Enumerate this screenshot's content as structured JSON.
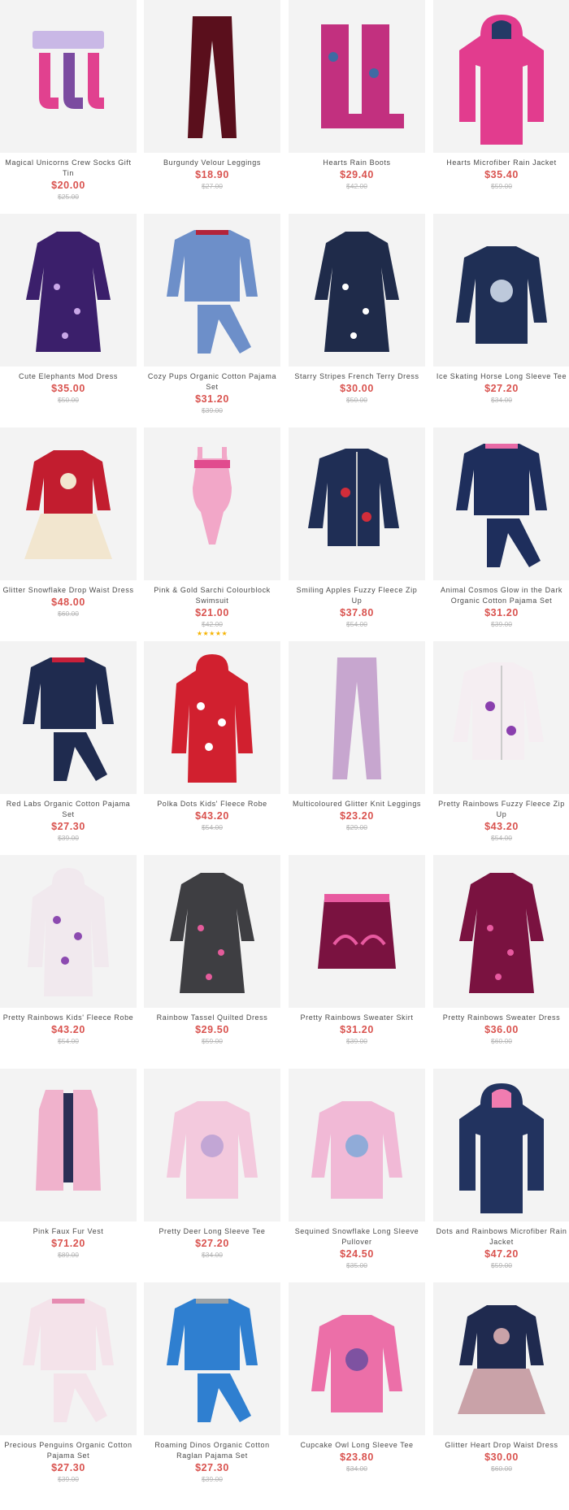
{
  "products": [
    {
      "name": "Magical Unicorns Crew Socks Gift Tin",
      "price": "$20.00",
      "was": "$25.00",
      "type": "socks",
      "color": "#e1418f",
      "accent": "#7b4ba0"
    },
    {
      "name": "Burgundy Velour Leggings",
      "price": "$18.90",
      "was": "$27.00",
      "type": "leggings",
      "color": "#5a0f1c",
      "accent": "#3a0610"
    },
    {
      "name": "Hearts Rain Boots",
      "price": "$29.40",
      "was": "$42.00",
      "type": "boots",
      "color": "#c2307f",
      "accent": "#3f6aa3"
    },
    {
      "name": "Hearts Microfiber Rain Jacket",
      "price": "$35.40",
      "was": "$59.00",
      "type": "jacket",
      "color": "#e23c8e",
      "accent": "#243a66"
    },
    {
      "name": "Cute Elephants Mod Dress",
      "price": "$35.00",
      "was": "$50.00",
      "type": "dress",
      "color": "#3b1f6b",
      "accent": "#c9a7e8"
    },
    {
      "name": "Cozy Pups Organic Cotton Pajama Set",
      "price": "$31.20",
      "was": "$39.00",
      "type": "pajama",
      "color": "#6d8fc9",
      "accent": "#b3243a"
    },
    {
      "name": "Starry Stripes French Terry Dress",
      "price": "$30.00",
      "was": "$50.00",
      "type": "dress",
      "color": "#1f2b4a",
      "accent": "#ffffff"
    },
    {
      "name": "Ice Skating Horse Long Sleeve Tee",
      "price": "$27.20",
      "was": "$34.00",
      "type": "tee",
      "color": "#1f2f55",
      "accent": "#d9e4f3"
    },
    {
      "name": "Glitter Snowflake Drop Waist Dress",
      "price": "$48.00",
      "was": "$60.00",
      "type": "tutu",
      "color": "#c21d2f",
      "accent": "#f2e6cf"
    },
    {
      "name": "Pink & Gold Sarchi Colourblock Swimsuit",
      "price": "$21.00",
      "was": "$42.00",
      "stars": "★★★★★",
      "type": "swimsuit",
      "color": "#f2a7c8",
      "accent": "#e14b8e"
    },
    {
      "name": "Smiling Apples Fuzzy Fleece Zip Up",
      "price": "$37.80",
      "was": "$54.00",
      "type": "fleece",
      "color": "#1f2e55",
      "accent": "#d12d3a"
    },
    {
      "name": "Animal Cosmos Glow in the Dark Organic Cotton Pajama Set",
      "price": "$31.20",
      "was": "$39.00",
      "type": "pajama",
      "color": "#1e2e5c",
      "accent": "#e86aa6"
    },
    {
      "name": "Red Labs Organic Cotton Pajama Set",
      "price": "$27.30",
      "was": "$39.00",
      "type": "pajama",
      "color": "#1f2b4f",
      "accent": "#c8203a"
    },
    {
      "name": "Polka Dots Kids' Fleece Robe",
      "price": "$43.20",
      "was": "$54.00",
      "type": "robe",
      "color": "#d1202f",
      "accent": "#ffffff"
    },
    {
      "name": "Multicoloured Glitter Knit Leggings",
      "price": "$23.20",
      "was": "$29.00",
      "type": "leggings",
      "color": "#c7a6cf",
      "accent": "#b48fbe"
    },
    {
      "name": "Pretty Rainbows Fuzzy Fleece Zip Up",
      "price": "$43.20",
      "was": "$54.00",
      "type": "fleece",
      "color": "#f5eef2",
      "accent": "#8a3fae"
    },
    {
      "name": "Pretty Rainbows Kids' Fleece Robe",
      "price": "$43.20",
      "was": "$54.00",
      "type": "robe",
      "color": "#f1e9ee",
      "accent": "#8c4ab0"
    },
    {
      "name": "Rainbow Tassel Quilted Dress",
      "price": "$29.50",
      "was": "$59.00",
      "type": "dress",
      "color": "#3e3e42",
      "accent": "#e45c9b"
    },
    {
      "name": "Pretty Rainbows Sweater Skirt",
      "price": "$31.20",
      "was": "$39.00",
      "type": "skirt",
      "color": "#7a1240",
      "accent": "#e85aa0"
    },
    {
      "name": "Pretty Rainbows Sweater Dress",
      "price": "$36.00",
      "was": "$60.00",
      "type": "dress",
      "color": "#7a1240",
      "accent": "#e85aa0"
    },
    {
      "name": "Pink Faux Fur Vest",
      "price": "$71.20",
      "was": "$89.00",
      "type": "vest",
      "color": "#f0b2cc",
      "accent": "#2a2f55"
    },
    {
      "name": "Pretty Deer Long Sleeve Tee",
      "price": "$27.20",
      "was": "$34.00",
      "type": "tee",
      "color": "#f3c9dd",
      "accent": "#b9a0d4"
    },
    {
      "name": "Sequined Snowflake Long Sleeve Pullover",
      "price": "$24.50",
      "was": "$35.00",
      "type": "tee",
      "color": "#f1b9d6",
      "accent": "#7fa8d8"
    },
    {
      "name": "Dots and Rainbows Microfiber Rain Jacket",
      "price": "$47.20",
      "was": "$59.00",
      "type": "jacket",
      "color": "#22335f",
      "accent": "#f07cb0"
    },
    {
      "name": "Precious Penguins Organic Cotton Pajama Set",
      "price": "$27.30",
      "was": "$39.00",
      "type": "pajama",
      "color": "#f4e3ea",
      "accent": "#e68bb1"
    },
    {
      "name": "Roaming Dinos Organic Cotton Raglan Pajama Set",
      "price": "$27.30",
      "was": "$39.00",
      "type": "pajama",
      "color": "#2f7fd0",
      "accent": "#9aa2a8"
    },
    {
      "name": "Cupcake Owl Long Sleeve Tee",
      "price": "$23.80",
      "was": "$34.00",
      "type": "tee",
      "color": "#ec6fa8",
      "accent": "#6b4ea0"
    },
    {
      "name": "Glitter Heart Drop Waist Dress",
      "price": "$30.00",
      "was": "$60.00",
      "type": "tutu",
      "color": "#1f2a4f",
      "accent": "#c9a2a8"
    }
  ]
}
